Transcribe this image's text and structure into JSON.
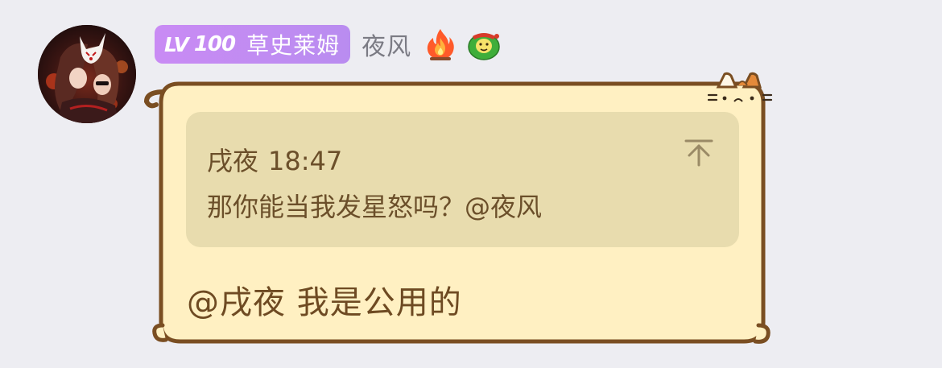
{
  "sender": {
    "level_lv": "LV",
    "level_number": "100",
    "level_title": "草史莱姆",
    "name": "夜风",
    "badges": [
      "fire-icon",
      "green-mask-icon"
    ]
  },
  "quote": {
    "author": "戌夜",
    "time": "18:47",
    "text": "那你能当我发星怒吗？@夜风",
    "jump_icon": "scroll-to-top-icon"
  },
  "message": {
    "text": "@戌夜 我是公用的"
  },
  "colors": {
    "background": "#ededf2",
    "bubble_fill": "#fff0c2",
    "bubble_outline": "#7a4e22",
    "quote_fill": "#e8dcae",
    "level_badge": "#c98bf4",
    "text_brown": "#6e4a22"
  }
}
